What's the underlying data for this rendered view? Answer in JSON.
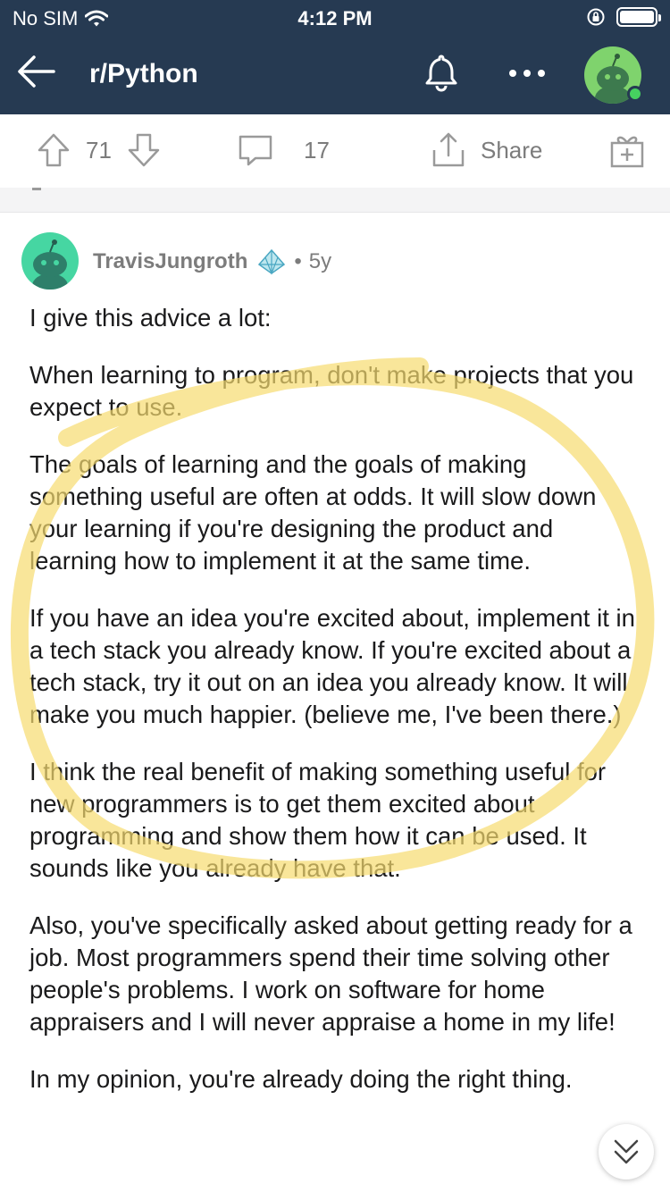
{
  "status_bar": {
    "carrier": "No SIM",
    "time": "4:12 PM"
  },
  "nav": {
    "title": "r/Python"
  },
  "actions": {
    "upvotes": "71",
    "comments": "17",
    "share_label": "Share"
  },
  "comment": {
    "username": "TravisJungroth",
    "separator": "•",
    "age": "5y",
    "paragraphs": [
      "I give this advice a lot:",
      "When learning to program, don't make projects that you expect to use.",
      "The goals of learning and the goals of making something useful are often at odds. It will slow down your learning if you're designing the product and learning how to implement it at the same time.",
      "If you have an idea you're excited about, implement it in a tech stack you already know. If you're excited about a tech stack, try it out on an idea you already know. It will make you much happier. (believe me, I've been there.)",
      "I think the real benefit of making something useful for new programmers is to get them excited about programming and show them how it can be used. It sounds like you already have that.",
      "Also, you've specifically asked about getting ready for a job. Most programmers spend their time solving other people's problems. I work on software for home appraisers and I will never appraise a home in my life!",
      "In my opinion, you're already doing the right thing."
    ]
  },
  "colors": {
    "header_bg": "#263a52",
    "avatar_green": "#7fd36d",
    "comment_avatar": "#46d6a2",
    "highlight": "#f7dc6f",
    "icon_gray": "#9a9a9a"
  }
}
